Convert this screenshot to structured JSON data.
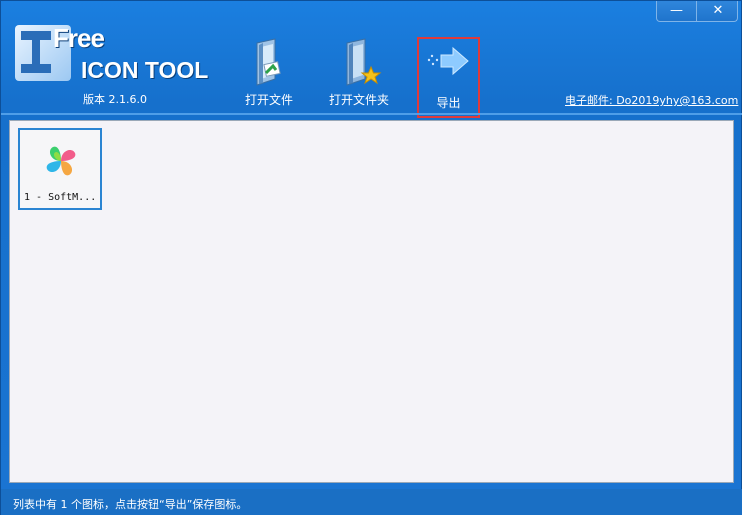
{
  "app": {
    "logo_line1": "Free",
    "logo_line2": "ICON TOOL",
    "version": "版本 2.1.6.0",
    "email": "电子邮件: Do2019yhy@163.com"
  },
  "window_controls": {
    "minimize_label": "—",
    "close_label": "✕"
  },
  "toolbar": {
    "open_file_label": "打开文件",
    "open_folder_label": "打开文件夹",
    "export_label": "导出",
    "export_highlight_color": "#e03a3a"
  },
  "icon_list": {
    "items": [
      {
        "name": "1 - SoftM...",
        "icon": "softmgr-petal-icon"
      }
    ]
  },
  "status_bar": {
    "text": "列表中有 1 个图标，点击按钮“导出”保存图标。"
  },
  "colors": {
    "header_blue": "#1b7fe0",
    "list_background": "#f4f3f8",
    "selection_border": "#2a84d2"
  }
}
